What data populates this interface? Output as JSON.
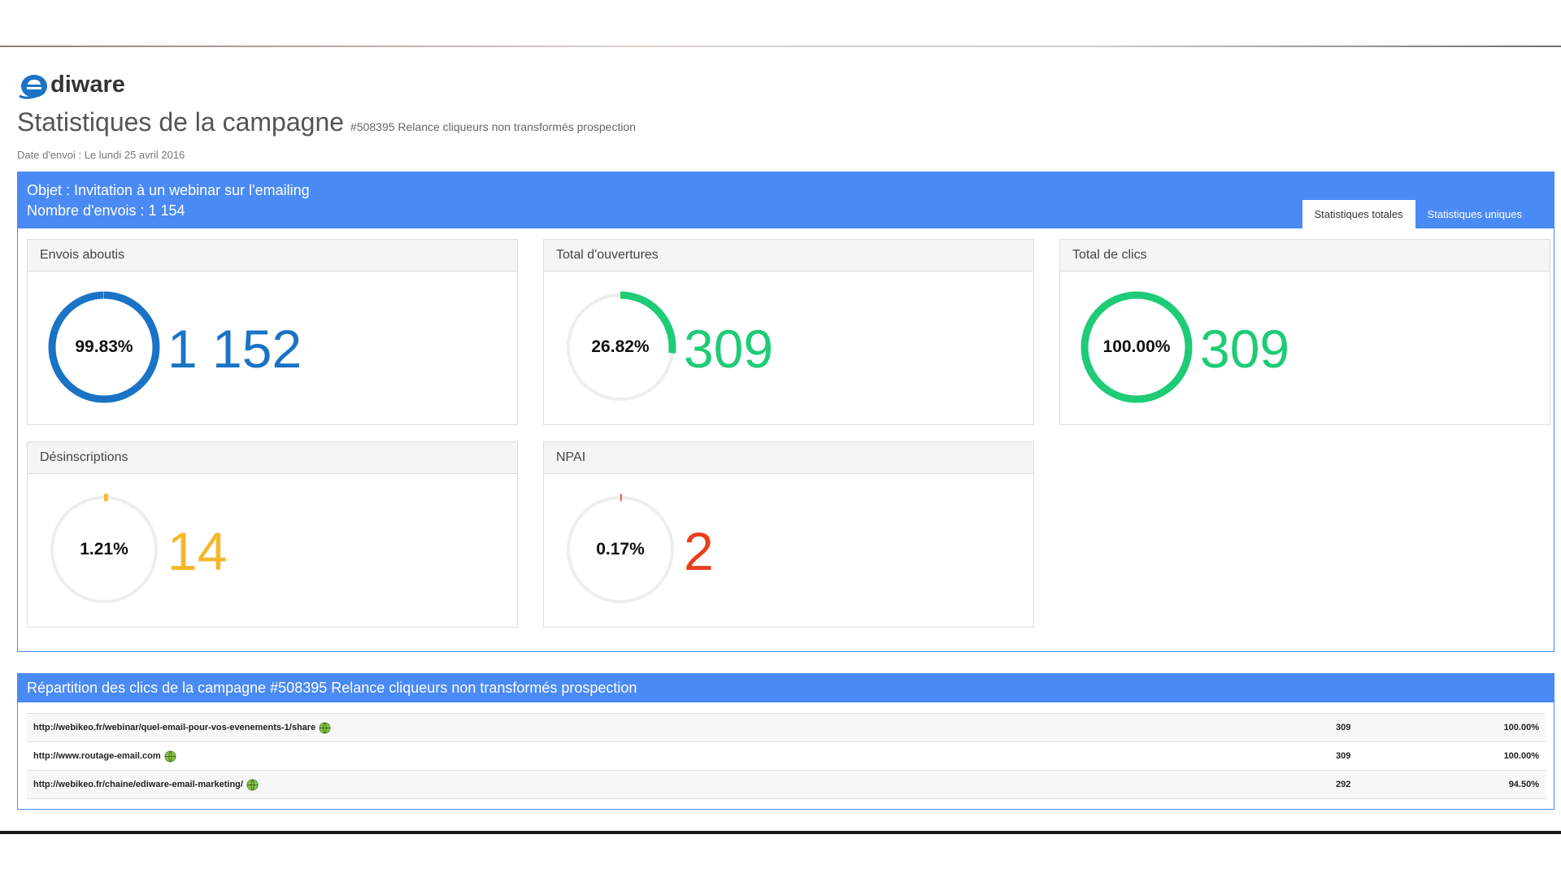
{
  "brand": {
    "logo_text": "diware"
  },
  "header": {
    "title": "Statistiques de la campagne",
    "campaign": "#508395 Relance cliqueurs non transformés prospection",
    "send_date": "Date d'envoi : Le lundi 25 avril 2016"
  },
  "summary": {
    "subject": "Objet : Invitation à un webinar sur l'emailing",
    "send_count": "Nombre d'envois : 1 154",
    "tabs": [
      {
        "label": "Statistiques totales",
        "active": true
      },
      {
        "label": "Statistiques uniques",
        "active": false
      }
    ]
  },
  "cards": [
    {
      "title": "Envois aboutis",
      "percent_label": "99.83%",
      "fraction": 0.9983,
      "value": "1 152",
      "color": "#1a73c4"
    },
    {
      "title": "Total d'ouvertures",
      "percent_label": "26.82%",
      "fraction": 0.2682,
      "value": "309",
      "color": "#1ecb76"
    },
    {
      "title": "Total de clics",
      "percent_label": "100.00%",
      "fraction": 1.0,
      "value": "309",
      "color": "#1ecb76"
    },
    {
      "title": "Désinscriptions",
      "percent_label": "1.21%",
      "fraction": 0.0121,
      "value": "14",
      "color": "#f5b72a"
    },
    {
      "title": "NPAI",
      "percent_label": "0.17%",
      "fraction": 0.0017,
      "value": "2",
      "color": "#e8401c"
    }
  ],
  "clicks": {
    "title": "Répartition des clics de la campagne #508395 Relance cliqueurs non transformés prospection",
    "rows": [
      {
        "url": "http://webikeo.fr/webinar/quel-email-pour-vos-evenements-1/share",
        "count": "309",
        "percent": "100.00%"
      },
      {
        "url": "http://www.routage-email.com",
        "count": "309",
        "percent": "100.00%"
      },
      {
        "url": "http://webikeo.fr/chaine/ediware-email-marketing/",
        "count": "292",
        "percent": "94.50%"
      }
    ]
  }
}
